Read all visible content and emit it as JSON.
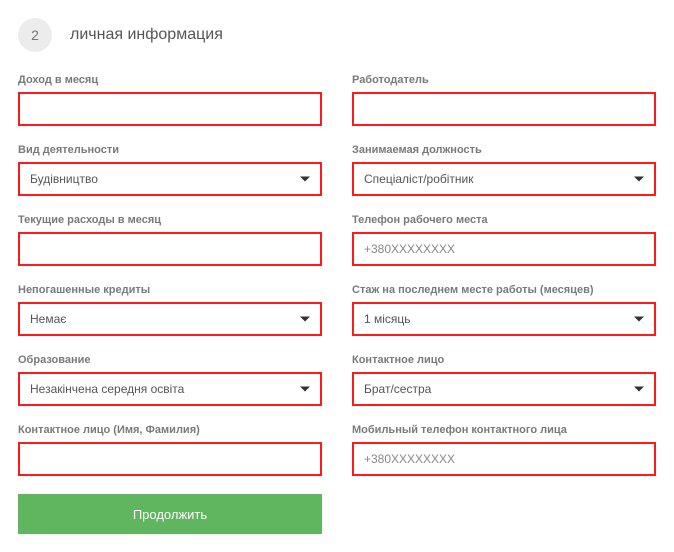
{
  "step": {
    "number": "2",
    "title": "личная информация"
  },
  "fields": {
    "income": {
      "label": "Доход в месяц",
      "value": "",
      "placeholder": ""
    },
    "employer": {
      "label": "Работодатель",
      "value": "",
      "placeholder": ""
    },
    "activity": {
      "label": "Вид деятельности",
      "value": "Будівництво"
    },
    "position": {
      "label": "Занимаемая должность",
      "value": "Спеціаліст/робітник"
    },
    "expenses": {
      "label": "Текущие расходы в месяц",
      "value": "",
      "placeholder": ""
    },
    "work_phone": {
      "label": "Телефон рабочего места",
      "value": "",
      "placeholder": "+380XXXXXXXX"
    },
    "loans": {
      "label": "Непогашенные кредиты",
      "value": "Немає"
    },
    "tenure": {
      "label": "Стаж на последнем месте работы (месяцев)",
      "value": "1 місяць"
    },
    "education": {
      "label": "Образование",
      "value": "Незакінчена середня освіта"
    },
    "contact_person": {
      "label": "Контактное лицо",
      "value": "Брат/сестра"
    },
    "contact_name": {
      "label": "Контактное лицо (Имя, Фамилия)",
      "value": "",
      "placeholder": ""
    },
    "contact_phone": {
      "label": "Мобильный телефон контактного лица",
      "value": "",
      "placeholder": "+380XXXXXXXX"
    }
  },
  "button": {
    "continue": "Продолжить"
  }
}
